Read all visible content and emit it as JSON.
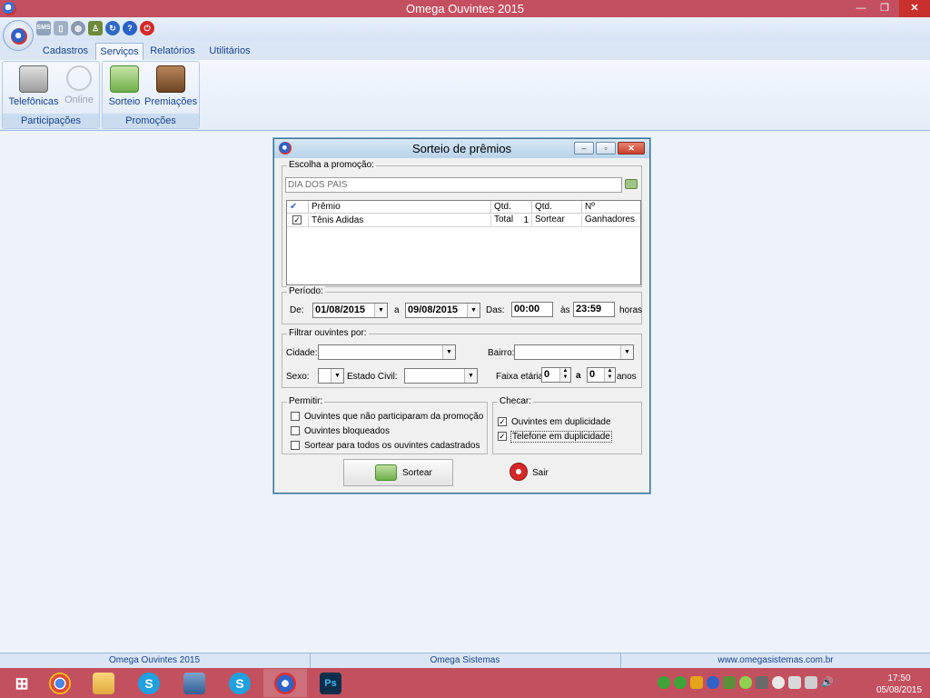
{
  "window": {
    "title": "Omega Ouvintes 2015",
    "min": "—",
    "max": "❐",
    "close": "✕"
  },
  "qat": [
    "SMS",
    "▯",
    "◍",
    "♙",
    "↻",
    "?",
    "⏻"
  ],
  "tabs": [
    "Cadastros",
    "Serviços",
    "Relatórios",
    "Utilitários"
  ],
  "ribbon": {
    "groups": [
      {
        "label": "Participações",
        "buttons": [
          "Telefônicas",
          "Online"
        ]
      },
      {
        "label": "Promoções",
        "buttons": [
          "Sorteio",
          "Premiações"
        ]
      }
    ]
  },
  "dialog": {
    "title": "Sorteio de prêmios",
    "promocao": {
      "legend": "Escolha a promoção:",
      "value": "DIA DOS PAIS"
    },
    "grid": {
      "headers": [
        "Prêmio",
        "Qtd. Total",
        "Qtd. Sortear",
        "Nº Ganhadores"
      ],
      "rows": [
        {
          "checked": true,
          "premio": "Tênis Adidas",
          "qtd_total": "1",
          "qtd_sortear": "",
          "ganhadores": ""
        }
      ]
    },
    "periodo": {
      "legend": "Período:",
      "de_label": "De:",
      "de_value": "01/08/2015",
      "a_label": "a",
      "ate_value": "09/08/2015",
      "das_label": "Das:",
      "das_value": "00:00",
      "as_label": "às",
      "as_value": "23:59",
      "horas_label": "horas"
    },
    "filtro": {
      "legend": "Filtrar ouvintes por:",
      "cidade_label": "Cidade:",
      "cidade_value": "",
      "bairro_label": "Bairro:",
      "bairro_value": "",
      "sexo_label": "Sexo:",
      "sexo_value": "",
      "estado_civil_label": "Estado Civil:",
      "estado_civil_value": "",
      "faixa_label": "Faixa etária:",
      "faixa_min": "0",
      "faixa_a": "a",
      "faixa_max": "0",
      "anos_label": "anos"
    },
    "permitir": {
      "legend": "Permitir:",
      "options": [
        {
          "label": "Ouvintes que não participaram da promoção",
          "checked": false
        },
        {
          "label": "Ouvintes bloqueados",
          "checked": false
        },
        {
          "label": "Sortear para todos os ouvintes cadastrados",
          "checked": false
        }
      ]
    },
    "checar": {
      "legend": "Checar:",
      "options": [
        {
          "label": "Ouvintes em duplicidade",
          "checked": true
        },
        {
          "label": "Telefone em duplicidade",
          "checked": true
        }
      ]
    },
    "buttons": {
      "sortear": "Sortear",
      "sair": "Sair"
    }
  },
  "statusbar": [
    "Omega Ouvintes 2015",
    "Omega Sistemas",
    "www.omegasistemas.com.br"
  ],
  "taskbar": {
    "apps": [
      "Chrome",
      "Explorador de arquivos",
      "Skype",
      "VirtualBox",
      "Skype",
      "Omega Ouvintes",
      "Photoshop"
    ]
  },
  "clock": {
    "time": "17:50",
    "date": "05/08/2015"
  }
}
